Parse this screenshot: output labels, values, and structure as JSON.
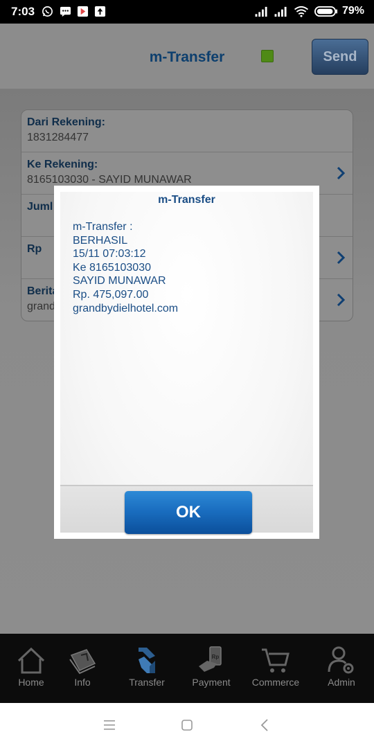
{
  "status_bar": {
    "time": "7:03",
    "battery_percent": "79%",
    "icons": [
      "whatsapp-icon",
      "message-icon",
      "play-store-icon",
      "upload-icon",
      "signal-icon",
      "signal-icon",
      "wifi-icon",
      "battery-icon"
    ]
  },
  "header": {
    "title": "m-Transfer",
    "send_label": "Send",
    "status_color": "#4f8a16"
  },
  "form": {
    "rows": [
      {
        "label": "Dari Rekening:",
        "value": "1831284477"
      },
      {
        "label": "Ke Rekening:",
        "value": "8165103030 - SAYID MUNAWAR"
      },
      {
        "label": "Juml",
        "value": ""
      },
      {
        "label": "Rp",
        "value": ""
      },
      {
        "label": "Berita",
        "value": "grand"
      }
    ]
  },
  "dialog": {
    "title": "m-Transfer",
    "lines": [
      "m-Transfer :",
      "BERHASIL",
      "15/11 07:03:12",
      "Ke 8165103030",
      "SAYID MUNAWAR",
      "Rp. 475,097.00",
      "grandbydielhotel.com"
    ],
    "ok_label": "OK"
  },
  "tabs": [
    {
      "label": "Home",
      "icon": "home-icon"
    },
    {
      "label": "Info",
      "icon": "info-book-icon"
    },
    {
      "label": "Transfer",
      "icon": "transfer-icon"
    },
    {
      "label": "Payment",
      "icon": "payment-icon"
    },
    {
      "label": "Commerce",
      "icon": "cart-icon"
    },
    {
      "label": "Admin",
      "icon": "admin-user-icon"
    }
  ],
  "colors": {
    "accent_blue": "#1a4d85",
    "ok_button": "#1a6ec0"
  }
}
